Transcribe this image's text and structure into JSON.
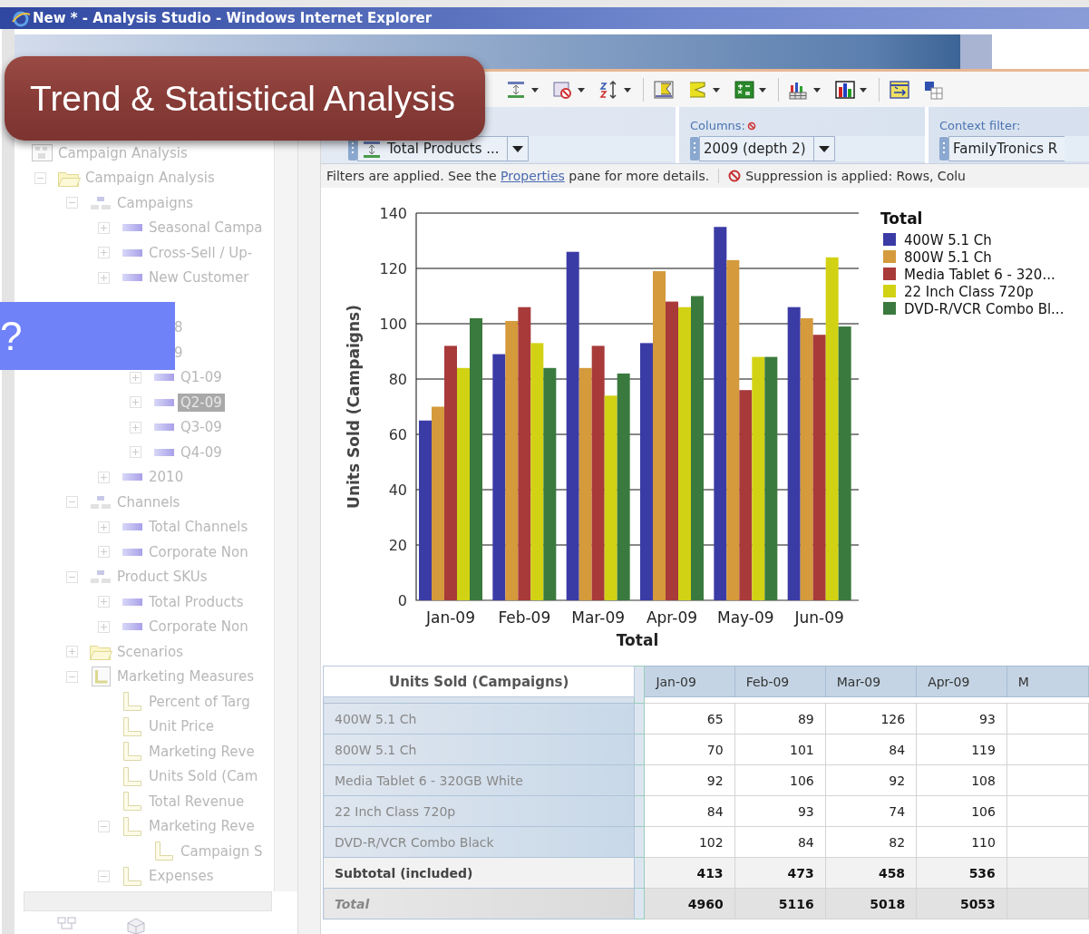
{
  "window": {
    "title": "New * - Analysis Studio - Windows Internet Explorer"
  },
  "toolbar": [
    [
      {
        "kind": "spacing",
        "dropdown": true
      },
      {
        "kind": "suppress",
        "dropdown": true
      },
      {
        "kind": "sort",
        "dropdown": true
      }
    ],
    [
      {
        "kind": "calculate",
        "dropdown": false
      },
      {
        "kind": "sum",
        "dropdown": true
      },
      {
        "kind": "spreadsheet",
        "dropdown": true
      }
    ],
    [
      {
        "kind": "bar-chart",
        "dropdown": true
      },
      {
        "kind": "column-chart",
        "dropdown": true
      }
    ],
    [
      {
        "kind": "swap",
        "dropdown": false
      },
      {
        "kind": "layout",
        "dropdown": false
      }
    ]
  ],
  "tree": [
    {
      "label": "Campaign Analysis",
      "kind": "package",
      "selected": false,
      "children": [
        {
          "label": "Campaign Analysis",
          "kind": "folder",
          "expanded": true,
          "selected": false,
          "children": [
            {
              "label": "Campaigns",
              "kind": "hierarchy",
              "expanded": true,
              "selected": false,
              "children": [
                {
                  "label": "Seasonal Campa",
                  "kind": "member",
                  "expanded": false,
                  "selected": false
                },
                {
                  "label": "Cross-Sell / Up-",
                  "kind": "member",
                  "expanded": false,
                  "selected": false
                },
                {
                  "label": "New Customer",
                  "kind": "member",
                  "expanded": false,
                  "selected": false
                }
              ]
            },
            {
              "children": [
                {
                  "label": "8",
                  "selected": false
                },
                {
                  "label": "9",
                  "selected": false,
                  "children": [
                    {
                      "label": "Q1-09",
                      "kind": "member",
                      "expanded": false,
                      "selected": false
                    },
                    {
                      "label": "Q2-09",
                      "kind": "member",
                      "expanded": false,
                      "selected": true
                    },
                    {
                      "label": "Q3-09",
                      "kind": "member",
                      "expanded": false,
                      "selected": false
                    },
                    {
                      "label": "Q4-09",
                      "kind": "member",
                      "expanded": false,
                      "selected": false
                    }
                  ]
                },
                {
                  "label": "2010",
                  "kind": "member",
                  "expanded": false,
                  "selected": false
                }
              ]
            },
            {
              "label": "Channels",
              "kind": "hierarchy",
              "expanded": true,
              "selected": false,
              "children": [
                {
                  "label": "Total Channels",
                  "kind": "member",
                  "expanded": false,
                  "selected": false
                },
                {
                  "label": "Corporate Non",
                  "kind": "member",
                  "expanded": false,
                  "selected": false
                }
              ]
            },
            {
              "label": "Product SKUs",
              "kind": "hierarchy",
              "expanded": true,
              "selected": false,
              "children": [
                {
                  "label": "Total Products",
                  "kind": "member",
                  "expanded": false,
                  "selected": false
                },
                {
                  "label": "Corporate Non",
                  "kind": "member",
                  "expanded": false,
                  "selected": false
                }
              ]
            },
            {
              "label": "Scenarios",
              "kind": "folder",
              "expanded": false,
              "selected": false
            },
            {
              "label": "Marketing Measures",
              "kind": "measures",
              "expanded": true,
              "selected": false,
              "children": [
                {
                  "label": "Percent of Targ",
                  "kind": "measure",
                  "selected": false
                },
                {
                  "label": "Unit Price",
                  "kind": "measure",
                  "selected": false
                },
                {
                  "label": "Marketing Reve",
                  "kind": "measure",
                  "selected": false
                },
                {
                  "label": "Units Sold (Cam",
                  "kind": "measure",
                  "selected": false
                },
                {
                  "label": "Total Revenue",
                  "kind": "measure",
                  "selected": false
                },
                {
                  "label": "Marketing Reve",
                  "kind": "measure",
                  "expanded": true,
                  "selected": false,
                  "children": [
                    {
                      "label": "Campaign S",
                      "kind": "measure",
                      "selected": false
                    }
                  ]
                },
                {
                  "label": "Expenses",
                  "kind": "measure",
                  "expanded": true,
                  "selected": false
                }
              ]
            }
          ]
        }
      ]
    }
  ],
  "filter_bar": {
    "rows": {
      "value": "Total Products ..."
    },
    "columns": {
      "label": "Columns:",
      "suppressed": true,
      "value": "2009 (depth 2)"
    },
    "context_filter": {
      "label": "Context filter:",
      "value": "FamilyTronics R"
    }
  },
  "info_bar": {
    "filters": {
      "before": "Filters are applied. See the ",
      "link": "Properties",
      "after": " pane for more details."
    },
    "suppression": "Suppression is applied: Rows, Colu"
  },
  "chart": {
    "legend_title": "Total",
    "chart_data": {
      "type": "bar",
      "xlabel": "Total",
      "ylabel": "Units Sold (Campaigns)",
      "categories": [
        "Jan-09",
        "Feb-09",
        "Mar-09",
        "Apr-09",
        "May-09",
        "Jun-09"
      ],
      "series": [
        {
          "name": "400W 5.1 Ch",
          "color": "#3b3ba6",
          "values": [
            65,
            89,
            126,
            93,
            135,
            106
          ]
        },
        {
          "name": "800W 5.1 Ch",
          "color": "#d49a3c",
          "values": [
            70,
            101,
            84,
            119,
            123,
            102
          ]
        },
        {
          "name": "Media Tablet 6 - 320...",
          "color": "#a83a3a",
          "values": [
            92,
            106,
            92,
            108,
            76,
            96
          ]
        },
        {
          "name": "22 Inch Class 720p",
          "color": "#d2d214",
          "values": [
            84,
            93,
            74,
            106,
            88,
            124
          ]
        },
        {
          "name": "DVD-R/VCR Combo Bl...",
          "color": "#3a7a3e",
          "values": [
            102,
            84,
            82,
            110,
            88,
            99
          ]
        }
      ],
      "ylim": [
        0,
        140
      ],
      "yticks": [
        0,
        20,
        40,
        60,
        80,
        100,
        120,
        140
      ],
      "grid": true,
      "legend": true
    }
  },
  "table": {
    "corner": "Units Sold (Campaigns)",
    "columns": [
      "Jan-09",
      "Feb-09",
      "Mar-09",
      "Apr-09",
      "M"
    ],
    "rows": [
      {
        "kind": "member",
        "label": "400W 5.1 Ch",
        "cells": [
          "65",
          "89",
          "126",
          "93"
        ]
      },
      {
        "kind": "member",
        "label": "800W 5.1 Ch",
        "cells": [
          "70",
          "101",
          "84",
          "119"
        ]
      },
      {
        "kind": "member",
        "label": "Media Tablet 6 - 320GB White",
        "cells": [
          "92",
          "106",
          "92",
          "108"
        ]
      },
      {
        "kind": "member",
        "label": "22 Inch Class 720p",
        "cells": [
          "84",
          "93",
          "74",
          "106"
        ]
      },
      {
        "kind": "member",
        "label": "DVD-R/VCR Combo Black",
        "cells": [
          "102",
          "84",
          "82",
          "110"
        ]
      },
      {
        "kind": "subtotal",
        "label": "Subtotal (included)",
        "cells": [
          "413",
          "473",
          "458",
          "536"
        ]
      },
      {
        "kind": "total",
        "label": "Total",
        "cells": [
          "4960",
          "5116",
          "5018",
          "5053"
        ]
      }
    ]
  },
  "callout": {
    "text": "Trend & Statistical Analysis"
  },
  "overlay_box": {
    "text": "?"
  }
}
